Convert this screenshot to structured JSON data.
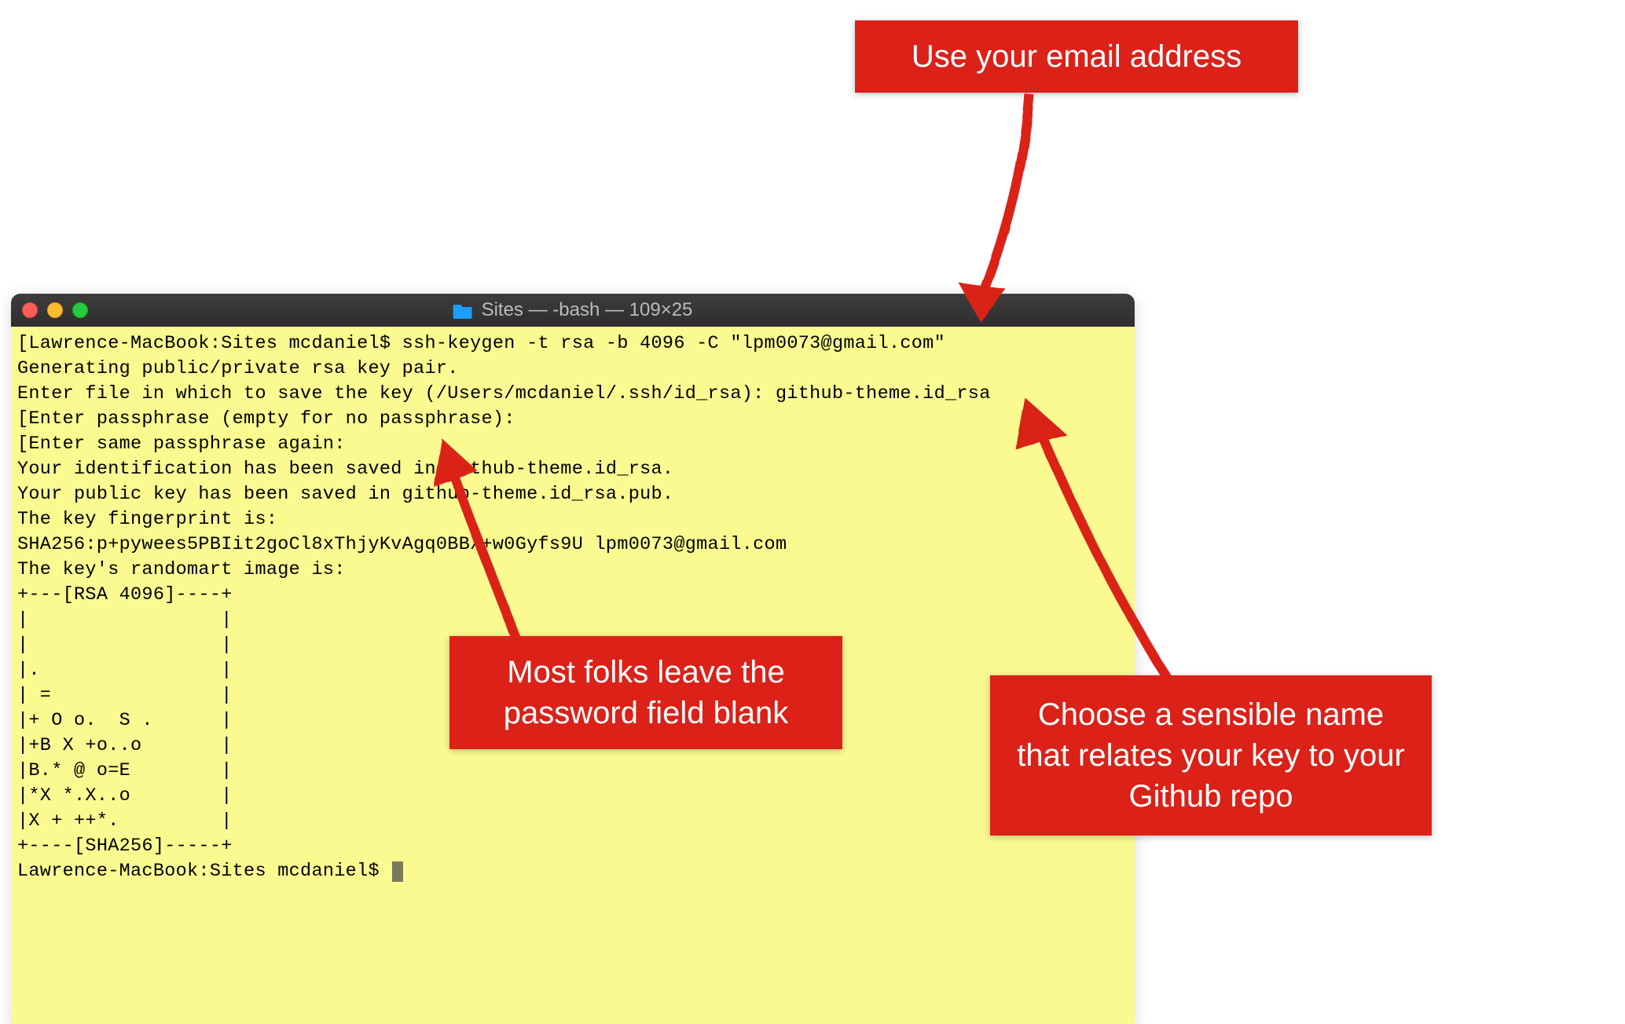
{
  "window": {
    "title": "Sites — -bash — 109×25",
    "folder_icon_color": "#1f9dff"
  },
  "terminal": {
    "lines": [
      "[Lawrence-MacBook:Sites mcdaniel$ ssh-keygen -t rsa -b 4096 -C \"lpm0073@gmail.com\"",
      "Generating public/private rsa key pair.",
      "Enter file in which to save the key (/Users/mcdaniel/.ssh/id_rsa): github-theme.id_rsa",
      "[Enter passphrase (empty for no passphrase):",
      "[Enter same passphrase again:",
      "Your identification has been saved in github-theme.id_rsa.",
      "Your public key has been saved in github-theme.id_rsa.pub.",
      "The key fingerprint is:",
      "SHA256:p+pywees5PBIit2goCl8xThjyKvAgq0BB/+w0Gyfs9U lpm0073@gmail.com",
      "The key's randomart image is:",
      "+---[RSA 4096]----+",
      "|                 |",
      "|                 |",
      "|.                |",
      "| =               |",
      "|+ O o.  S .      |",
      "|+B X +o..o       |",
      "|B.* @ o=E        |",
      "|*X *.X..o        |",
      "|X + ++*.         |",
      "+----[SHA256]-----+",
      "Lawrence-MacBook:Sites mcdaniel$ "
    ]
  },
  "callouts": {
    "c1": "Use your email address",
    "c2": "Most folks leave the password field blank",
    "c3": "Choose a sensible name that relates your key to your Github repo"
  },
  "colors": {
    "callout_bg": "#db2118",
    "terminal_bg": "#fafa91"
  }
}
